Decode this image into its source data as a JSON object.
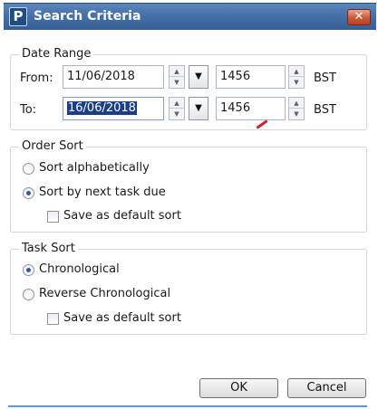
{
  "window": {
    "title": "Search Criteria",
    "app_icon_letter": "P",
    "close_glyph": "✕"
  },
  "date_range": {
    "legend": "Date Range",
    "from": {
      "label": "From:",
      "date": "11/06/2018",
      "time": "1456",
      "timezone": "BST"
    },
    "to": {
      "label": "To:",
      "date": "16/06/2018",
      "time": "1456",
      "timezone": "BST"
    }
  },
  "order_sort": {
    "legend": "Order Sort",
    "options": [
      {
        "label": "Sort alphabetically",
        "checked": false
      },
      {
        "label": "Sort by next task due",
        "checked": true
      }
    ],
    "save_default": {
      "label": "Save as default sort",
      "checked": false
    }
  },
  "task_sort": {
    "legend": "Task Sort",
    "options": [
      {
        "label": "Chronological",
        "checked": true
      },
      {
        "label": "Reverse Chronological",
        "checked": false
      }
    ],
    "save_default": {
      "label": "Save as default sort",
      "checked": false
    }
  },
  "buttons": {
    "ok": "OK",
    "cancel": "Cancel"
  },
  "icons": {
    "spin_up": "▲",
    "spin_down": "▼",
    "dropdown": "▼"
  },
  "colors": {
    "titlebar": "#4470a8",
    "selection": "#1b3e8a",
    "accent_line": "#5a9ad6"
  }
}
